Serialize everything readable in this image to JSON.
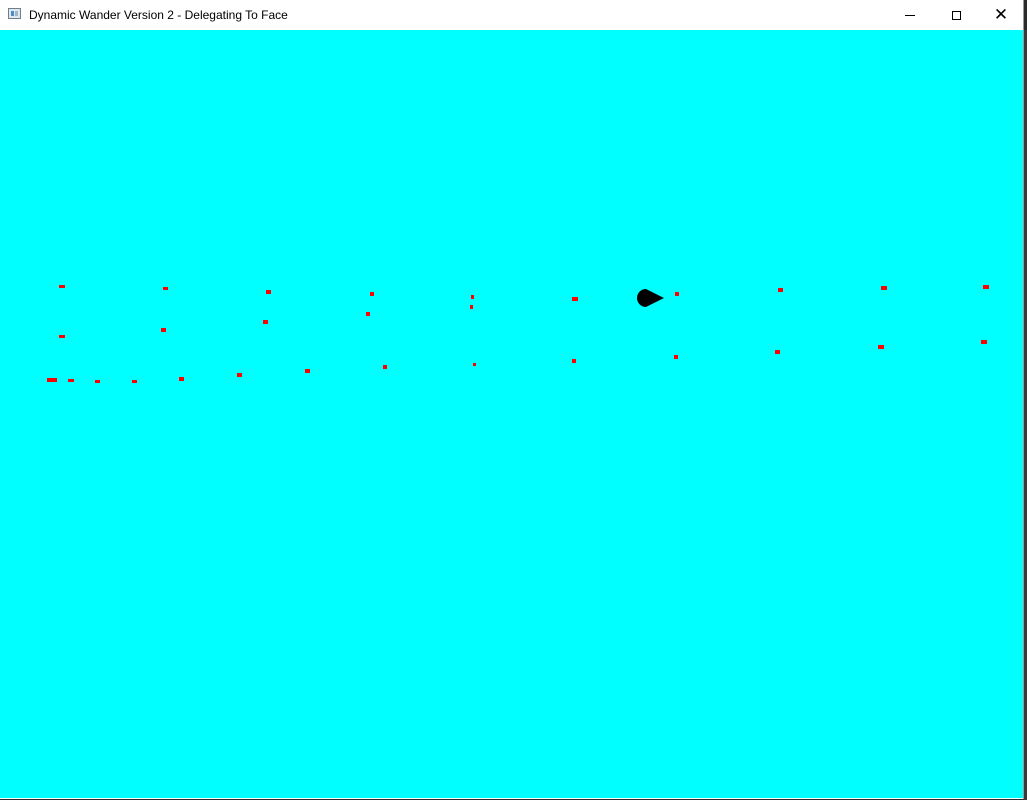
{
  "window": {
    "title": "Dynamic Wander Version 2 - Delegating To Face",
    "icon": "app-window-icon",
    "controls": {
      "minimize_icon": "minimize-icon",
      "maximize_icon": "maximize-icon",
      "close_icon": "close-icon",
      "close_glyph": "✕"
    }
  },
  "scene": {
    "background_color": "#00ffff",
    "breadcrumb_color": "#ff0000",
    "agent_color": "#000000",
    "agent_icon": "teardrop-agent",
    "breadcrumb_icon": "breadcrumb-dot"
  }
}
